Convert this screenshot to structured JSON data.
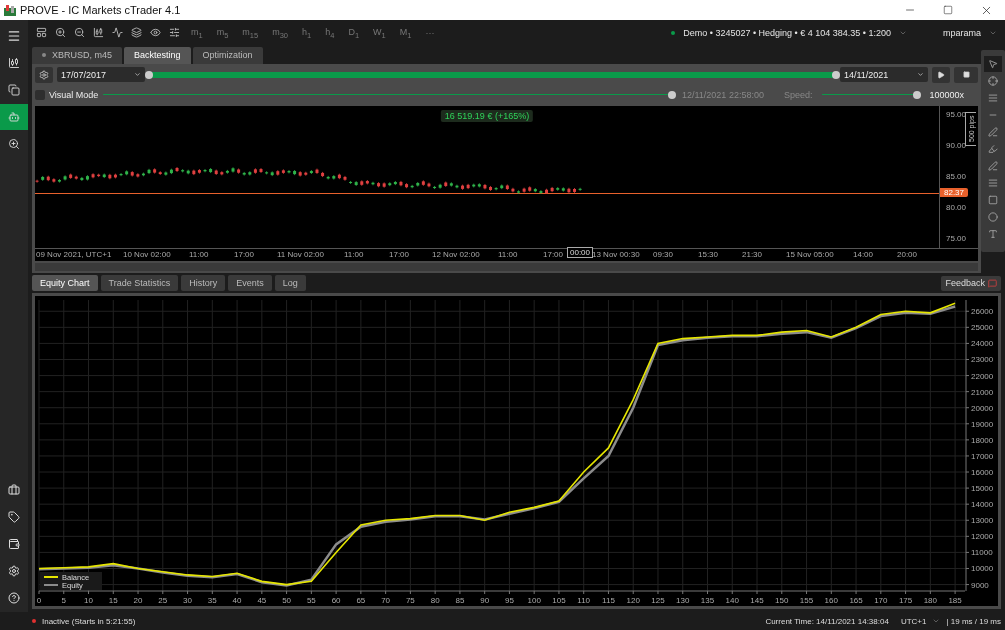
{
  "window": {
    "title": "PROVE - IC Markets cTrader 4.1"
  },
  "toolbar": {
    "timeframes": [
      "m$_{1}$",
      "m$_{5}$",
      "m$_{15}$",
      "m$_{30}$",
      "h$_{1}$",
      "h$_{4}$",
      "D$_{1}$",
      "W$_{1}$",
      "M$_{1}$"
    ],
    "more": "···"
  },
  "account": {
    "summary": "Demo • 3245027 • Hedging • € 4 104 384.35 • 1:200",
    "user": "mparama"
  },
  "sidebar": {
    "items": [
      {
        "kind": "chart",
        "selected": false
      },
      {
        "kind": "copy",
        "selected": false
      },
      {
        "kind": "bot",
        "selected": true
      },
      {
        "kind": "analyze",
        "selected": false
      }
    ]
  },
  "chart_tabs": [
    {
      "label": "XBRUSD, m45",
      "kind": "symbol",
      "selected": false
    },
    {
      "label": "Backtesting",
      "kind": "mode",
      "selected": true
    },
    {
      "label": "Optimization",
      "kind": "mode",
      "selected": false
    }
  ],
  "backtest": {
    "start_date": "17/07/2017",
    "end_date": "14/11/2021",
    "range": {
      "level": 1
    },
    "visual_mode": {
      "label": "Visual Mode",
      "checked": false
    },
    "progress": {
      "level": 1,
      "time": "12/11/2021 22:58:00"
    },
    "speed": {
      "label": "Speed:",
      "level": 1,
      "value": "100000x"
    }
  },
  "price_chart": {
    "result": "16 519.19 € (+165%)",
    "scale_label": "500 pips",
    "price_ticks": [
      "95.00",
      "90.00",
      "85.00",
      "80.00",
      "75.00"
    ],
    "current_price": "82.37",
    "cursor_time": "00:00",
    "time_labels": [
      "09 Nov 2021, UTC+1",
      "10 Nov 02:00",
      "11:00",
      "17:00",
      "11 Nov 02:00",
      "11:00",
      "17:00",
      "12 Nov 02:00",
      "11:00",
      "17:00",
      "13 Nov 00:30",
      "09:30",
      "15:30",
      "21:30",
      "15 Nov 05:00",
      "14:00",
      "20:00"
    ]
  },
  "results_tabs": [
    {
      "label": "Equity Chart",
      "selected": true
    },
    {
      "label": "Trade Statistics",
      "selected": false
    },
    {
      "label": "History",
      "selected": false
    },
    {
      "label": "Events",
      "selected": false
    },
    {
      "label": "Log",
      "selected": false
    }
  ],
  "feedback": "Feedback",
  "equity_chart": {
    "chart_data": {
      "type": "line",
      "x": [
        0,
        5,
        10,
        15,
        20,
        25,
        30,
        35,
        40,
        45,
        50,
        55,
        60,
        65,
        70,
        75,
        80,
        85,
        90,
        95,
        100,
        105,
        110,
        115,
        120,
        125,
        130,
        135,
        140,
        145,
        150,
        155,
        160,
        165,
        170,
        175,
        180,
        185
      ],
      "series": [
        {
          "name": "Balance",
          "color": "#e6e600",
          "values": [
            10000,
            10050,
            10100,
            10300,
            10000,
            9800,
            9600,
            9500,
            9700,
            9200,
            9000,
            9200,
            11000,
            12700,
            13000,
            13100,
            13300,
            13300,
            13000,
            13500,
            13800,
            14200,
            16000,
            17500,
            20500,
            24000,
            24300,
            24400,
            24500,
            24500,
            24700,
            24800,
            24400,
            25000,
            25800,
            26000,
            25900,
            26500
          ]
        },
        {
          "name": "Equity",
          "color": "#8c8c8c",
          "values": [
            9950,
            10000,
            10050,
            10200,
            10000,
            9750,
            9550,
            9450,
            9650,
            9150,
            8950,
            9300,
            11500,
            12600,
            12900,
            13050,
            13250,
            13250,
            13050,
            13400,
            13750,
            14150,
            15600,
            17000,
            20000,
            23900,
            24200,
            24350,
            24450,
            24450,
            24600,
            24700,
            24350,
            24950,
            25700,
            25900,
            25850,
            26300
          ]
        }
      ],
      "xlim": [
        0,
        187
      ],
      "ylim": [
        8600,
        26700
      ],
      "grid": true,
      "legend": "lower left",
      "xticks": [
        0,
        5,
        10,
        15,
        20,
        25,
        30,
        35,
        40,
        45,
        50,
        55,
        60,
        65,
        70,
        75,
        80,
        85,
        90,
        95,
        100,
        105,
        110,
        115,
        120,
        125,
        130,
        135,
        140,
        145,
        150,
        155,
        160,
        165,
        170,
        175,
        180,
        185
      ],
      "yticks": [
        9000,
        10000,
        11000,
        12000,
        13000,
        14000,
        15000,
        16000,
        17000,
        18000,
        19000,
        20000,
        21000,
        22000,
        23000,
        24000,
        25000,
        26000
      ]
    }
  },
  "status_bar": {
    "state": "Inactive (Starts in 5:21:55)",
    "current_time": "Current Time: 14/11/2021 14:38:04",
    "timezone": "UTC+1",
    "latency": "| 19 ms / 19 ms"
  }
}
